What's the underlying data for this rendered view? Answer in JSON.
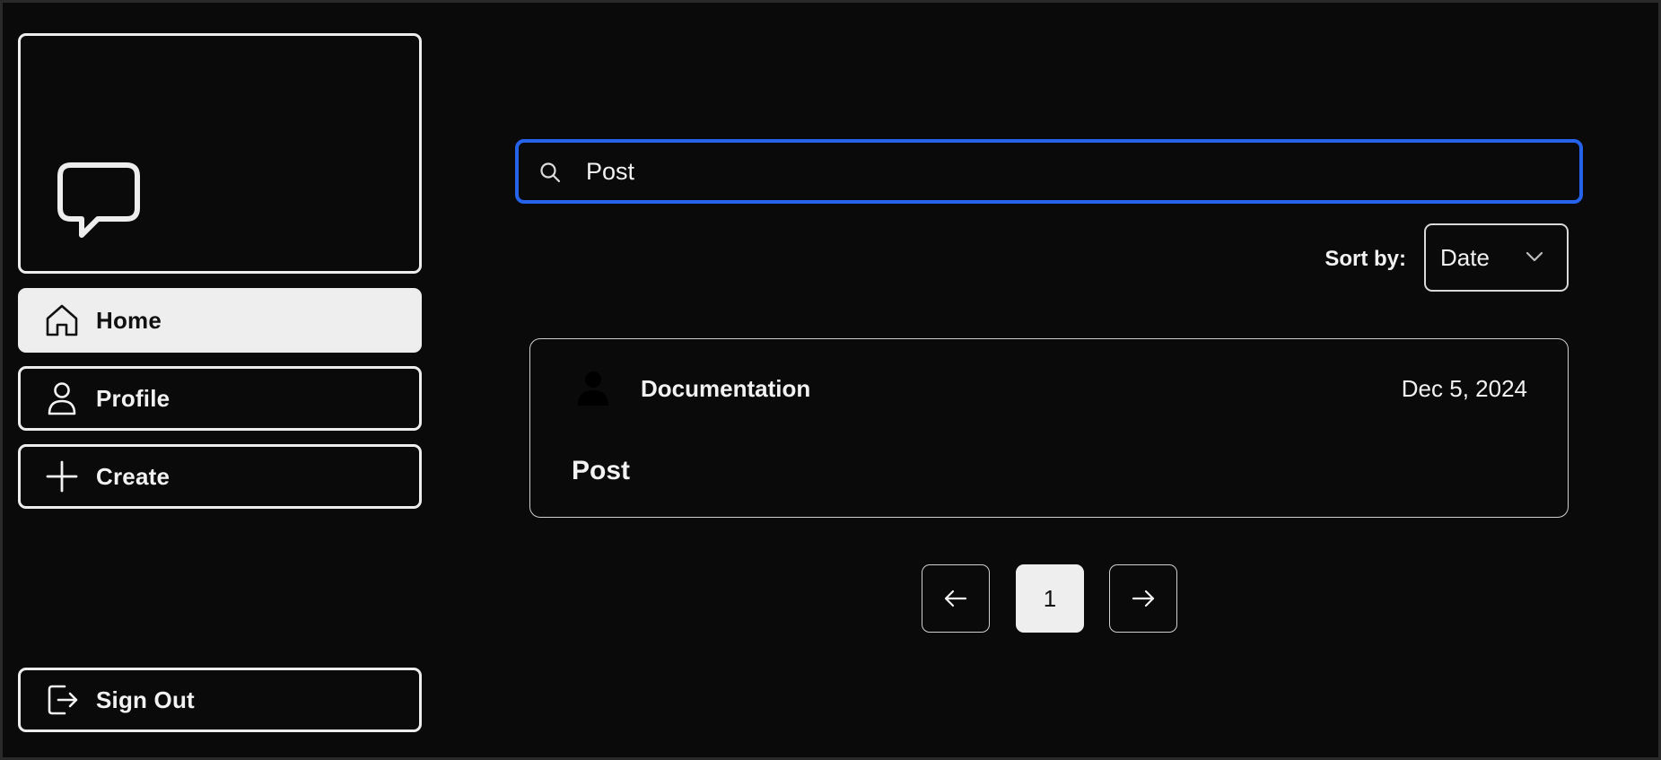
{
  "sidebar": {
    "nav": [
      {
        "label": "Home",
        "icon": "home-icon",
        "active": true
      },
      {
        "label": "Profile",
        "icon": "user-icon",
        "active": false
      },
      {
        "label": "Create",
        "icon": "plus-icon",
        "active": false
      }
    ],
    "sign_out_label": "Sign Out",
    "logo_icon": "chat-bubble-icon"
  },
  "search": {
    "value": "Post",
    "placeholder": "",
    "icon": "search-icon"
  },
  "sort": {
    "label": "Sort by:",
    "selected": "Date"
  },
  "posts": [
    {
      "author": "Documentation",
      "date": "Dec 5, 2024",
      "title": "Post"
    }
  ],
  "pagination": {
    "current_page": "1"
  },
  "colors": {
    "background": "#0a0a0a",
    "accent_focus": "#2563eb",
    "active_nav_bg": "#eeeeee",
    "text": "#f2f2f2"
  }
}
